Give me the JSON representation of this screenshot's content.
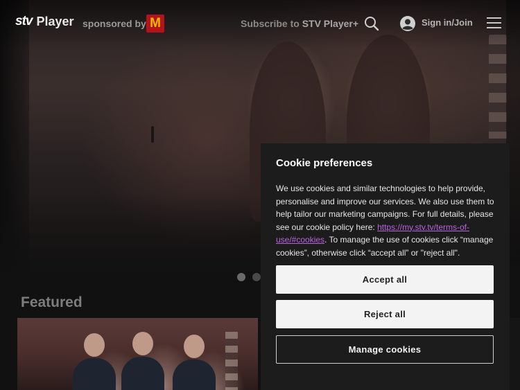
{
  "header": {
    "logo_stv": "stv",
    "logo_player": "Player",
    "sponsored_label": "sponsored by",
    "sponsor_logo": "M",
    "subscribe_prefix": "Subscribe to",
    "subscribe_product": "STV Player+",
    "signin_label": "Sign in/Join",
    "icons": {
      "search": "search-icon",
      "account": "user-icon",
      "menu": "hamburger-icon"
    }
  },
  "carousel": {
    "dot_count": 2,
    "active_index": 0
  },
  "featured": {
    "title": "Featured"
  },
  "cookie": {
    "title": "Cookie preferences",
    "text_before_link": "We use cookies and similar technologies to help provide, personalise and improve our services. We also use them to help tailor our marketing campaigns. For full details, please see our cookie policy here: ",
    "link_text": "https://my.stv.tv/terms-of-use/#cookies",
    "text_after_link": ". To manage the use of cookies click “manage cookies”, otherwise click “accept all” or \"reject all\".",
    "accept_label": "Accept all",
    "reject_label": "Reject all",
    "manage_label": "Manage cookies"
  },
  "colors": {
    "link": "#b865e0",
    "sponsor_bg": "#b3131b",
    "sponsor_fg": "#f2b800",
    "modal_bg": "#1c1c1c"
  }
}
